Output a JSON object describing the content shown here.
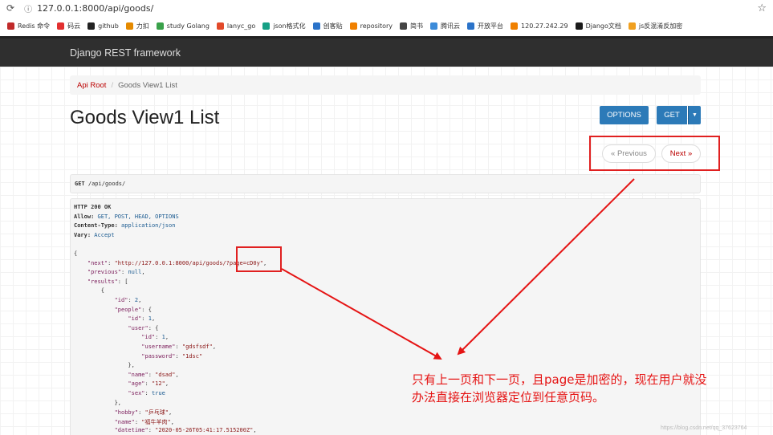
{
  "browser": {
    "url": "127.0.0.1:8000/api/goods/"
  },
  "bookmarks": [
    "Redis 命令",
    "码云",
    "github",
    "力扣",
    "study Golang",
    "lanyc_go",
    "json格式化",
    "创客贴",
    "repository",
    "简书",
    "腾讯云",
    "开放平台",
    "120.27.242.29",
    "Django文档",
    "js反混淆反加密"
  ],
  "bookmark_colors": [
    "#c02a2a",
    "#e23030",
    "#222222",
    "#e58a00",
    "#3aa14a",
    "#e24a2a",
    "#16a085",
    "#2b73c9",
    "#f08000",
    "#444444",
    "#3c8bd9",
    "#2b73c9",
    "#f08000",
    "#1a1a1a",
    "#f0a020"
  ],
  "navbar": {
    "brand": "Django REST framework"
  },
  "breadcrumb": {
    "root": "Api Root",
    "sep": "/",
    "current": "Goods View1 List"
  },
  "page_title": "Goods View1 List",
  "buttons": {
    "options": "OPTIONS",
    "get": "GET",
    "caret": "▼"
  },
  "pager": {
    "prev": "« Previous",
    "next": "Next »"
  },
  "request": {
    "method": "GET",
    "path": " /api/goods/"
  },
  "response": {
    "lines": [
      [
        [
          "b",
          "HTTP 200 OK"
        ]
      ],
      [
        [
          "b",
          "Allow: "
        ],
        [
          "v",
          "GET, POST, HEAD, OPTIONS"
        ]
      ],
      [
        [
          "b",
          "Content-Type: "
        ],
        [
          "v",
          "application/json"
        ]
      ],
      [
        [
          "b",
          "Vary: "
        ],
        [
          "v",
          "Accept"
        ]
      ],
      [
        [
          "",
          ""
        ]
      ],
      [
        [
          "",
          "{"
        ]
      ],
      [
        [
          "k",
          "    \"next\""
        ],
        [
          "",
          ": "
        ],
        [
          "s",
          "\"http://127.0.0.1:8000/api/goods/?page=cD0y\""
        ],
        [
          "",
          ","
        ]
      ],
      [
        [
          "k",
          "    \"previous\""
        ],
        [
          "",
          ": "
        ],
        [
          "v",
          "null"
        ],
        [
          "",
          ","
        ]
      ],
      [
        [
          "k",
          "    \"results\""
        ],
        [
          "",
          ": ["
        ]
      ],
      [
        [
          "",
          "        {"
        ]
      ],
      [
        [
          "k",
          "            \"id\""
        ],
        [
          "",
          ": "
        ],
        [
          "v",
          "2"
        ],
        [
          "",
          ","
        ]
      ],
      [
        [
          "k",
          "            \"people\""
        ],
        [
          "",
          ": {"
        ]
      ],
      [
        [
          "k",
          "                \"id\""
        ],
        [
          "",
          ": "
        ],
        [
          "v",
          "1"
        ],
        [
          "",
          ","
        ]
      ],
      [
        [
          "k",
          "                \"user\""
        ],
        [
          "",
          ": {"
        ]
      ],
      [
        [
          "k",
          "                    \"id\""
        ],
        [
          "",
          ": "
        ],
        [
          "v",
          "1"
        ],
        [
          "",
          ","
        ]
      ],
      [
        [
          "k",
          "                    \"username\""
        ],
        [
          "",
          ": "
        ],
        [
          "s",
          "\"gdsfsdf\""
        ],
        [
          "",
          ","
        ]
      ],
      [
        [
          "k",
          "                    \"password\""
        ],
        [
          "",
          ": "
        ],
        [
          "s",
          "\"1dsc\""
        ]
      ],
      [
        [
          "",
          "                },"
        ]
      ],
      [
        [
          "k",
          "                \"name\""
        ],
        [
          "",
          ": "
        ],
        [
          "s",
          "\"dsad\""
        ],
        [
          "",
          ","
        ]
      ],
      [
        [
          "k",
          "                \"age\""
        ],
        [
          "",
          ": "
        ],
        [
          "s",
          "\"12\""
        ],
        [
          "",
          ","
        ]
      ],
      [
        [
          "k",
          "                \"sex\""
        ],
        [
          "",
          ": "
        ],
        [
          "v",
          "true"
        ]
      ],
      [
        [
          "",
          "            },"
        ]
      ],
      [
        [
          "k",
          "            \"hobby\""
        ],
        [
          "",
          ": "
        ],
        [
          "s",
          "\"乒乓球\""
        ],
        [
          "",
          ","
        ]
      ],
      [
        [
          "k",
          "            \"name\""
        ],
        [
          "",
          ": "
        ],
        [
          "s",
          "\"福牛羊肉\""
        ],
        [
          "",
          ","
        ]
      ],
      [
        [
          "k",
          "            \"datetime\""
        ],
        [
          "",
          ": "
        ],
        [
          "s",
          "\"2020-05-26T05:41:17.515200Z\""
        ],
        [
          "",
          ","
        ]
      ]
    ]
  },
  "annotation": {
    "line1": "只有上一页和下一页，且page是加密的，现在用户就没",
    "line2": "办法直接在浏览器定位到任意页码。"
  },
  "watermark": "https://blog.csdn.net/qq_37623764",
  "colors": {
    "accent": "#2c7ab8",
    "annotation": "#e51414",
    "link": "#b00000"
  }
}
